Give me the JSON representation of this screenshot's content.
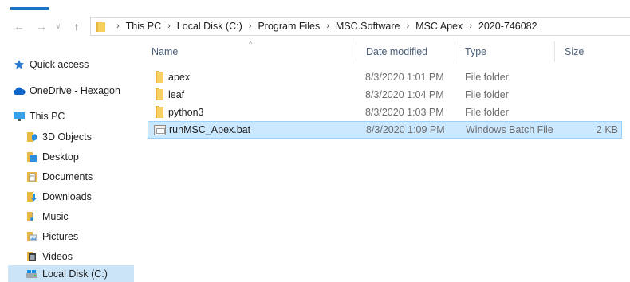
{
  "nav": {
    "back_glyph": "←",
    "forward_glyph": "→",
    "dropdown_glyph": "∨",
    "up_glyph": "↑"
  },
  "breadcrumb": [
    "This PC",
    "Local Disk (C:)",
    "Program Files",
    "MSC.Software",
    "MSC Apex",
    "2020-746082"
  ],
  "columns": {
    "name": "Name",
    "date": "Date modified",
    "type": "Type",
    "size": "Size"
  },
  "sidebar": {
    "items": [
      {
        "label": "Quick access",
        "icon": "star-icon"
      },
      {
        "label": "OneDrive - Hexagon",
        "icon": "cloud-icon"
      },
      {
        "label": "This PC",
        "icon": "computer-icon"
      },
      {
        "label": "3D Objects",
        "icon": "3d-objects-icon"
      },
      {
        "label": "Desktop",
        "icon": "desktop-icon"
      },
      {
        "label": "Documents",
        "icon": "documents-icon"
      },
      {
        "label": "Downloads",
        "icon": "downloads-icon"
      },
      {
        "label": "Music",
        "icon": "music-icon"
      },
      {
        "label": "Pictures",
        "icon": "pictures-icon"
      },
      {
        "label": "Videos",
        "icon": "videos-icon"
      },
      {
        "label": "Local Disk (C:)",
        "icon": "drive-icon"
      }
    ]
  },
  "files": [
    {
      "name": "apex",
      "date": "8/3/2020 1:01 PM",
      "type": "File folder",
      "size": "",
      "icon": "folder-icon"
    },
    {
      "name": "leaf",
      "date": "8/3/2020 1:04 PM",
      "type": "File folder",
      "size": "",
      "icon": "folder-icon"
    },
    {
      "name": "python3",
      "date": "8/3/2020 1:03 PM",
      "type": "File folder",
      "size": "",
      "icon": "folder-icon"
    },
    {
      "name": "runMSC_Apex.bat",
      "date": "8/3/2020 1:09 PM",
      "type": "Windows Batch File",
      "size": "2 KB",
      "icon": "batch-file-icon"
    }
  ],
  "colors": {
    "accent": "#1a73c7",
    "selected_row": "#cce8ff",
    "selected_sidebar": "#cce4f7",
    "folder": "#f8d162"
  }
}
